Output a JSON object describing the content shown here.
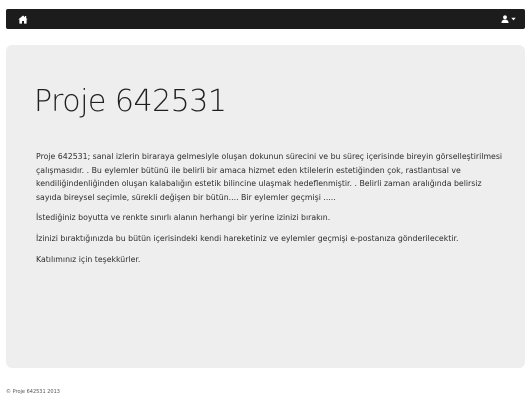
{
  "navbar": {
    "home_icon": "home-icon",
    "user_icon": "user-icon",
    "dropdown_icon": "caret-down-icon"
  },
  "main": {
    "title": "Proje 642531",
    "paragraphs": [
      "Proje 642531; sanal izlerin biraraya gelmesiyle oluşan dokunun sürecini ve bu süreç içerisinde bireyin görselleştirilmesi çalışmasıdır. . Bu eylemler bütünü ile belirli bir amaca hizmet eden ktilelerin estetiğinden çok, rastlantısal ve kendiliğindenliğinden oluşan kalabalığın estetik bilincine ulaşmak hedeflenmiştir. . Belirli zaman aralığında belirsiz sayıda bireysel seçimle, sürekli değişen bir bütün.... Bir eylemler geçmişi .....",
      "İstediğiniz boyutta ve renkte sınırlı alanın herhangi bir yerine izinizi bırakın.",
      "İzinizi bıraktığınızda bu bütün içerisindeki kendi hareketiniz ve eylemler geçmişi e-postanıza gönderilecektir.",
      "Katılımınız için teşekkürler."
    ]
  },
  "footer": {
    "text": "© Proje 642531 2013"
  }
}
